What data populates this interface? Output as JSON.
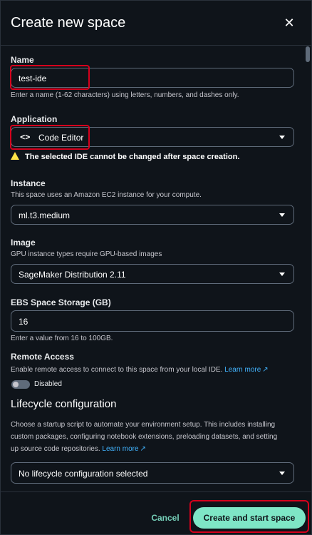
{
  "dialog": {
    "title": "Create new space",
    "close_icon": "close-icon"
  },
  "name": {
    "label": "Name",
    "value": "test-ide",
    "hint": "Enter a name (1-62 characters) using letters, numbers, and dashes only."
  },
  "application": {
    "label": "Application",
    "selected": "Code Editor",
    "icon": "code-icon",
    "warning": "The selected IDE cannot be changed after space creation."
  },
  "instance": {
    "label": "Instance",
    "desc": "This space uses an Amazon EC2 instance for your compute.",
    "selected": "ml.t3.medium"
  },
  "image": {
    "label": "Image",
    "desc": "GPU instance types require GPU-based images",
    "selected": "SageMaker Distribution 2.11"
  },
  "storage": {
    "label": "EBS Space Storage (GB)",
    "value": "16",
    "hint": "Enter a value from 16 to 100GB."
  },
  "remote": {
    "label": "Remote Access",
    "desc": "Enable remote access to connect to this space from your local IDE.",
    "link": "Learn more",
    "toggle_label": "Disabled"
  },
  "lifecycle": {
    "title": "Lifecycle configuration",
    "desc_line1": "Choose a startup script to automate your environment setup. This includes installing",
    "desc_line2": "custom packages, configuring notebook extensions, preloading datasets, and setting",
    "desc_line3": "up source code repositories.",
    "link": "Learn more",
    "selected": "No lifecycle configuration selected"
  },
  "footer": {
    "cancel": "Cancel",
    "create": "Create and start space"
  },
  "colors": {
    "accent": "#7ee6c6",
    "link": "#42b4ff",
    "warning": "#ffe347",
    "highlight": "#d6001c"
  }
}
